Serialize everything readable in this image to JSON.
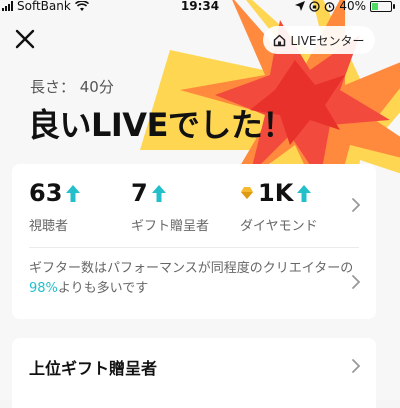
{
  "status_bar": {
    "carrier": "SoftBank",
    "time": "19:34",
    "battery": "40%",
    "battery_level": 0.4
  },
  "header": {
    "live_center_label": "LIVEセンター"
  },
  "summary": {
    "duration": "長さ： 40分",
    "headline": "良いLIVEでした！"
  },
  "stats": [
    {
      "value": "63",
      "label": "視聴者"
    },
    {
      "value": "7",
      "label": "ギフト贈呈者"
    },
    {
      "value": "1K",
      "label": "ダイヤモンド"
    }
  ],
  "note": {
    "text_before": "ギフター数はパフォーマンスが同程度のクリエイターの",
    "percent": "98%",
    "text_after": "よりも多いです"
  },
  "top_gifters": {
    "title": "上位ギフト贈呈者"
  },
  "colors": {
    "accent_teal": "#23c0cc",
    "burst_red": "#f24a3d",
    "burst_orange": "#ff8a3d",
    "burst_yellow": "#ffd23f"
  },
  "icons": [
    "close-icon",
    "home-icon",
    "arrow-up-icon",
    "diamond-icon",
    "chevron-right-icon",
    "wifi-icon",
    "location-icon",
    "alarm-icon"
  ]
}
